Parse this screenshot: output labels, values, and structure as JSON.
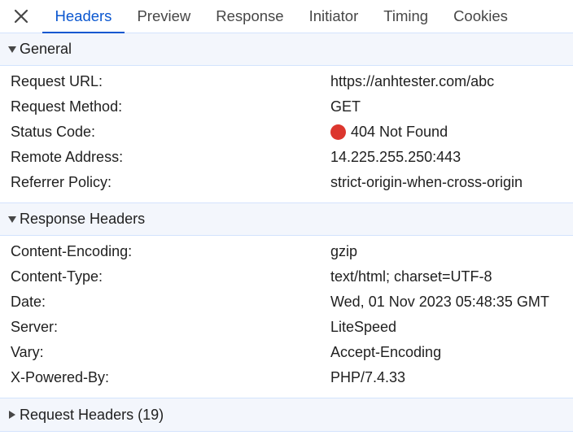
{
  "tabs": [
    {
      "label": "Headers"
    },
    {
      "label": "Preview"
    },
    {
      "label": "Response"
    },
    {
      "label": "Initiator"
    },
    {
      "label": "Timing"
    },
    {
      "label": "Cookies"
    }
  ],
  "active_tab": "Headers",
  "colors": {
    "accent": "#0b57d0",
    "status_error": "#dc362e",
    "header_bg": "#f3f6fc",
    "divider": "#d3e3fd"
  },
  "general": {
    "title": "General",
    "rows": [
      {
        "key": "Request URL:",
        "value": "https://anhtester.com/abc"
      },
      {
        "key": "Request Method:",
        "value": "GET"
      },
      {
        "key": "Status Code:",
        "value": "404 Not Found"
      },
      {
        "key": "Remote Address:",
        "value": "14.225.255.250:443"
      },
      {
        "key": "Referrer Policy:",
        "value": "strict-origin-when-cross-origin"
      }
    ]
  },
  "response_headers": {
    "title": "Response Headers",
    "rows": [
      {
        "key": "Content-Encoding:",
        "value": "gzip"
      },
      {
        "key": "Content-Type:",
        "value": "text/html; charset=UTF-8"
      },
      {
        "key": "Date:",
        "value": "Wed, 01 Nov 2023 05:48:35 GMT"
      },
      {
        "key": "Server:",
        "value": "LiteSpeed"
      },
      {
        "key": "Vary:",
        "value": "Accept-Encoding"
      },
      {
        "key": "X-Powered-By:",
        "value": "PHP/7.4.33"
      }
    ]
  },
  "request_headers": {
    "title": "Request Headers (19)"
  }
}
